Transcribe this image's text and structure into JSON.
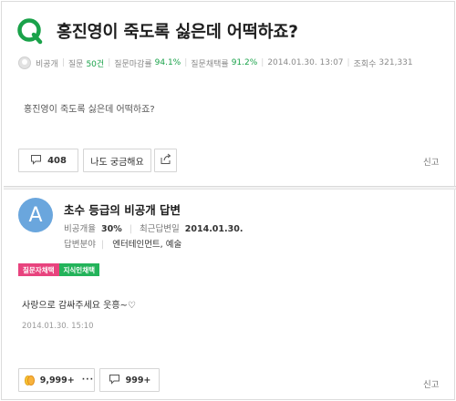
{
  "question": {
    "title": "홍진영이 죽도록 싫은데 어떡하죠?",
    "body": "홍진영이 죽도록 싫은데 어떡하죠?",
    "meta": {
      "author": "비공개",
      "questions_label": "질문",
      "questions_value": "50건",
      "close_rate_label": "질문마감률",
      "close_rate_value": "94.1%",
      "adopt_rate_label": "질문채택률",
      "adopt_rate_value": "91.2%",
      "datetime": "2014.01.30. 13:07",
      "views_label": "조회수",
      "views_value": "321,331"
    },
    "answers_count": "408",
    "curious_label": "나도 궁금해요",
    "report_label": "신고"
  },
  "answer": {
    "avatar_letter": "A",
    "title": "초수 등급의 비공개 답변",
    "adopt_rate_label": "비공개율",
    "adopt_rate_value": "30%",
    "recent_label": "최근답변일",
    "recent_value": "2014.01.30.",
    "field_label": "답변분야",
    "field_value": "엔터테인먼트, 예술",
    "badge_questioner": "질문자채택",
    "badge_jisikin": "지식인채택",
    "body": "사랑으로 감싸주세요 웃흥~♡",
    "date": "2014.01.30. 15:10",
    "reaction_count": "9,999+",
    "reaction_more": "···",
    "comments_count": "999+",
    "report_label": "신고"
  },
  "colors": {
    "brand_green": "#1aa24a",
    "badge_pink": "#e8437e",
    "badge_green": "#23b35a",
    "avatar_blue": "#6aa6dd"
  },
  "icons": [
    "q-logo-icon",
    "user-avatar-icon",
    "speech-bubble-icon",
    "share-icon",
    "emoji-reaction-icon"
  ]
}
